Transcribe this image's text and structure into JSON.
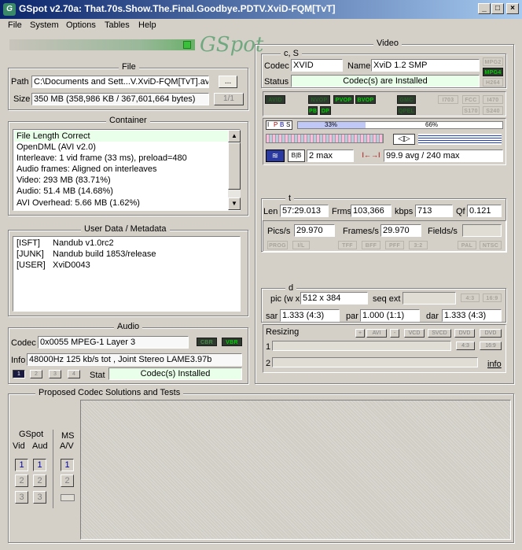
{
  "window": {
    "title": "GSpot v2.70a: That.70s.Show.The.Final.Goodbye.PDTV.XviD-FQM[TvT]"
  },
  "menu": [
    "File",
    "System",
    "Options",
    "Tables",
    "Help"
  ],
  "logo": "GSpot",
  "file": {
    "group_title": "File",
    "path_label": "Path",
    "path_value": "C:\\Documents and Sett...V.XviD-FQM[TvT].avi",
    "browse_label": "...",
    "size_label": "Size",
    "size_value": "350 MB (358,986 KB / 367,601,664 bytes)",
    "file_counter": "1/1"
  },
  "container": {
    "group_title": "Container",
    "lines": [
      "File Length Correct",
      "OpenDML (AVI v2.0)",
      "Interleave: 1 vid frame (33 ms), preload=480",
      "Audio frames: Aligned on interleaves",
      "Video: 293 MB (83.71%)",
      "Audio: 51.4 MB (14.68%)",
      "AVI Overhead: 5.66 MB (1.62%)"
    ]
  },
  "metadata": {
    "group_title": "User Data / Metadata",
    "rows": [
      {
        "tag": "[ISFT]",
        "value": "Nandub v1.0rc2"
      },
      {
        "tag": "[JUNK]",
        "value": "Nandub build 1853/release"
      },
      {
        "tag": "[USER]",
        "value": "XviD0043"
      }
    ]
  },
  "audio": {
    "group_title": "Audio",
    "codec_label": "Codec",
    "codec_value": "0x0055  MPEG-1 Layer 3",
    "cbr": "CBR",
    "vbr": "VBR",
    "info_label": "Info",
    "info_value": "48000Hz  125 kb/s tot , Joint Stereo LAME3.97b",
    "stream_buttons": [
      "1",
      "2",
      "3",
      "4"
    ],
    "stat_label": "Stat",
    "stat_value": "Codec(s) Installed"
  },
  "video": {
    "group_title": "Video",
    "cs_title": "c, S",
    "codec_label": "Codec",
    "codec_value": "XVID",
    "name_label": "Name",
    "name_value": "XviD 1.2 SMP",
    "status_label": "Status",
    "status_value": "Codec(s) are Installed",
    "format_leds": [
      "MPG2",
      "MPG4",
      "H264"
    ],
    "flag_leds": [
      {
        "label": "AVID",
        "on": false
      },
      {
        "label": "NVOP",
        "on": false
      },
      {
        "label": "PVOP",
        "on": true
      },
      {
        "label": "BVOP",
        "on": true
      },
      {
        "label": "PB",
        "on": true
      },
      {
        "label": "DP",
        "on": true
      },
      {
        "label": "GMC",
        "on": false
      },
      {
        "label": "QPEL",
        "on": false
      },
      {
        "label": "I703",
        "on": false
      },
      {
        "label": "FCC",
        "on": false
      },
      {
        "label": "I470",
        "on": false
      },
      {
        "label": "S170",
        "on": false
      },
      {
        "label": "S240",
        "on": false
      }
    ],
    "frame_types": [
      "I",
      "P",
      "B",
      "S"
    ],
    "pct_a": "33%",
    "pct_b": "66%",
    "bframes_max": "2 max",
    "bitrate": "99.9 avg / 240 max",
    "t_title": "t",
    "len_label": "Len",
    "len_value": "57:29.013",
    "frms_label": "Frms",
    "frms_value": "103,366",
    "kbps_label": "kbps",
    "kbps_value": "713",
    "qf_label": "Qf",
    "qf_value": "0.121",
    "pics_label": "Pics/s",
    "pics_value": "29.970",
    "frames_label": "Frames/s",
    "frames_value": "29.970",
    "fields_label": "Fields/s",
    "fields_value": "",
    "t_leds": [
      "PROG",
      "I/L",
      "TFF",
      "BFF",
      "PFF",
      "3:2",
      "PAL",
      "NTSC"
    ],
    "d_title": "d",
    "pic_label": "pic (w x h)",
    "pic_value": "512 x 384",
    "seqext_label": "seq ext",
    "aspect_leds": [
      "4:3",
      "16:9"
    ],
    "sar_label": "sar",
    "sar_value": "1.333 (4:3)",
    "par_label": "par",
    "par_value": "1.000 (1:1)",
    "dar_label": "dar",
    "dar_value": "1.333 (4:3)",
    "resizing_label": "Resizing",
    "resize_buttons": [
      "+",
      "AVI",
      "-",
      "VCD",
      "SVCD",
      "DVD",
      "DVD"
    ],
    "row1_label": "1",
    "row2_label": "2",
    "aspect_btns": [
      "4:3",
      "16:9"
    ],
    "info_link": "info"
  },
  "proposed": {
    "group_title": "Proposed Codec Solutions and Tests",
    "gspot_label": "GSpot",
    "vid_label": "Vid",
    "aud_label": "Aud",
    "ms_label": "MS",
    "av_label": "A/V",
    "buttons": [
      "1",
      "2",
      "3"
    ]
  },
  "colors": {
    "titlebar_start": "#0a246a",
    "titlebar_end": "#a6caf0",
    "face": "#d4d0c8",
    "led_on": "#00d000",
    "status_green": "#e9ffe9"
  }
}
